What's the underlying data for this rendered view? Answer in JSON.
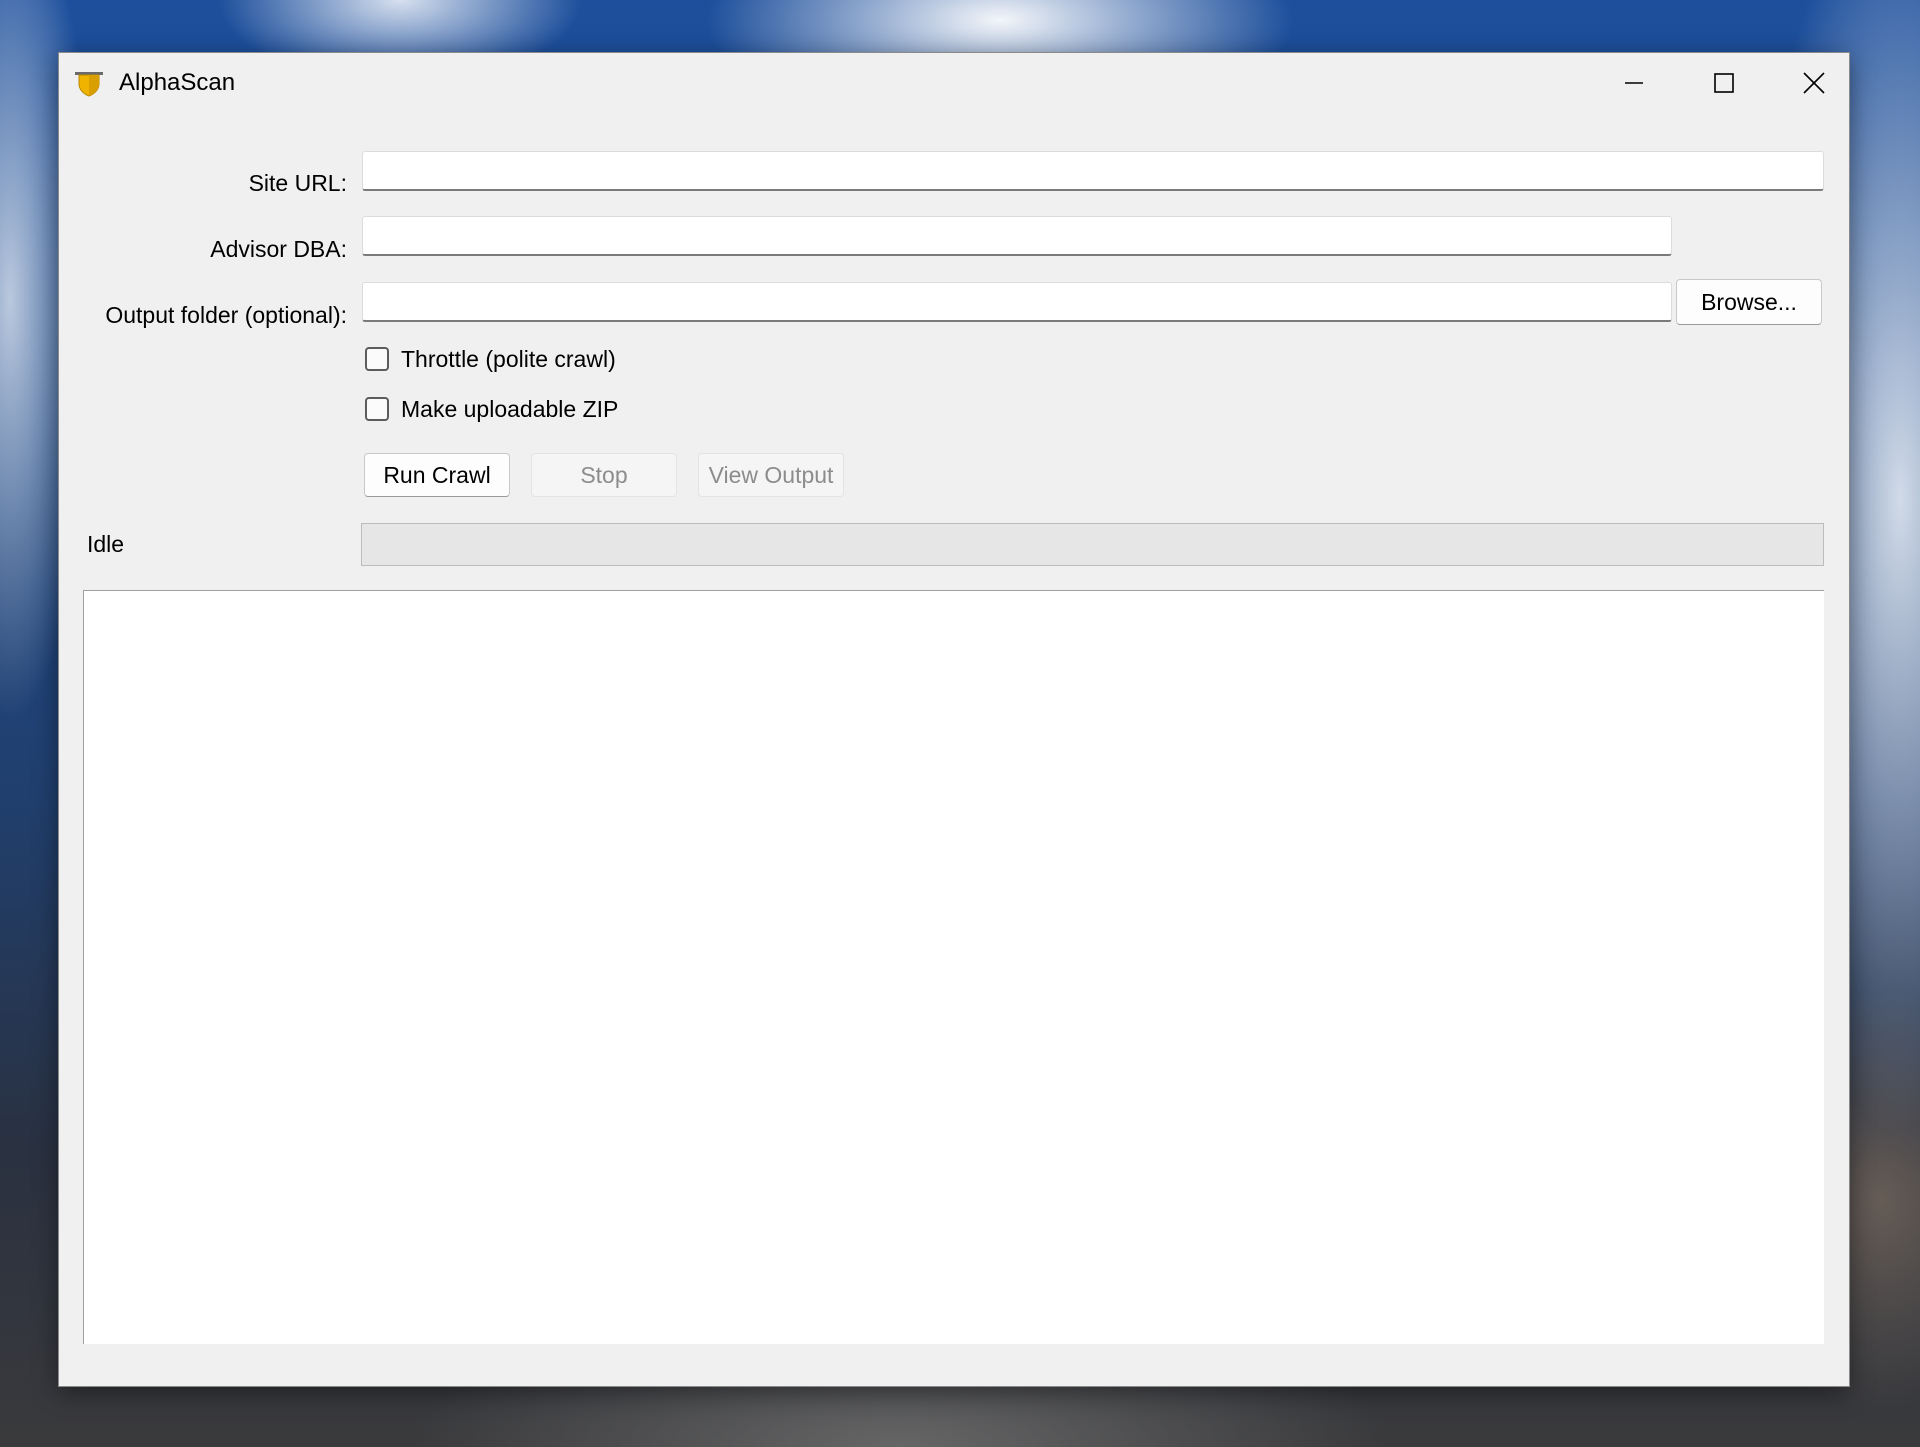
{
  "window": {
    "title": "AlphaScan",
    "icon": "shield-icon",
    "controls": {
      "minimize": "minimize-icon",
      "maximize": "maximize-icon",
      "close": "close-icon"
    }
  },
  "form": {
    "site_url": {
      "label": "Site URL:",
      "value": ""
    },
    "advisor_dba": {
      "label": "Advisor DBA:",
      "value": ""
    },
    "output_folder": {
      "label": "Output folder (optional):",
      "value": "",
      "browse_label": "Browse..."
    }
  },
  "options": {
    "throttle": {
      "label": "Throttle (polite crawl)",
      "checked": false
    },
    "zip": {
      "label": "Make uploadable ZIP",
      "checked": false
    }
  },
  "actions": {
    "run_label": "Run Crawl",
    "stop_label": "Stop",
    "view_label": "View Output"
  },
  "status": {
    "text": "Idle",
    "progress": 0
  },
  "log": {
    "content": ""
  },
  "colors": {
    "window_bg": "#f0f0f0",
    "icon_gold": "#f0b400",
    "disabled_text": "#8c8c8c"
  }
}
